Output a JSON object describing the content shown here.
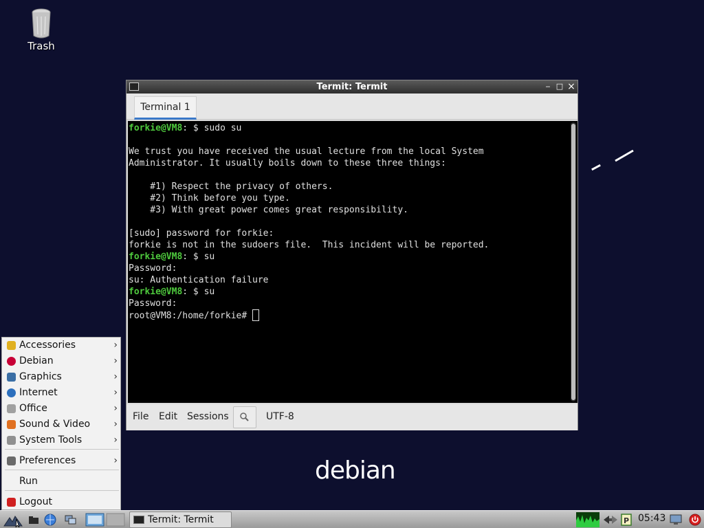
{
  "desktop": {
    "trash_label": "Trash",
    "logo_text": "debian"
  },
  "window": {
    "title": "Termit: Termit",
    "minimize": "‒",
    "maximize": "□",
    "close": "×"
  },
  "tabs": [
    {
      "label": "Terminal 1"
    }
  ],
  "terminal": {
    "lines": [
      {
        "prompt": "forkie@VM8",
        "text": ": $ sudo su"
      },
      {
        "text": ""
      },
      {
        "text": "We trust you have received the usual lecture from the local System"
      },
      {
        "text": "Administrator. It usually boils down to these three things:"
      },
      {
        "text": ""
      },
      {
        "text": "    #1) Respect the privacy of others."
      },
      {
        "text": "    #2) Think before you type."
      },
      {
        "text": "    #3) With great power comes great responsibility."
      },
      {
        "text": ""
      },
      {
        "text": "[sudo] password for forkie:"
      },
      {
        "text": "forkie is not in the sudoers file.  This incident will be reported."
      },
      {
        "prompt": "forkie@VM8",
        "text": ": $ su"
      },
      {
        "text": "Password:"
      },
      {
        "text": "su: Authentication failure"
      },
      {
        "prompt": "forkie@VM8",
        "text": ": $ su"
      },
      {
        "text": "Password:"
      },
      {
        "text": "root@VM8:/home/forkie# ",
        "cursor": true
      }
    ]
  },
  "menubar": {
    "file": "File",
    "edit": "Edit",
    "sessions": "Sessions",
    "encoding": "UTF-8"
  },
  "startmenu": {
    "items": [
      {
        "label": "Accessories",
        "icon": "accessories-icon",
        "color": "#e0b020",
        "submenu": true
      },
      {
        "label": "Debian",
        "icon": "debian-swirl-icon",
        "color": "#c70036",
        "submenu": true
      },
      {
        "label": "Graphics",
        "icon": "graphics-icon",
        "color": "#3a6ea5",
        "submenu": true
      },
      {
        "label": "Internet",
        "icon": "globe-icon",
        "color": "#2c6fbd",
        "submenu": true
      },
      {
        "label": "Office",
        "icon": "office-icon",
        "color": "#a0a0a0",
        "submenu": true
      },
      {
        "label": "Sound & Video",
        "icon": "sound-video-icon",
        "color": "#e07020",
        "submenu": true
      },
      {
        "label": "System Tools",
        "icon": "system-tools-icon",
        "color": "#909090",
        "submenu": true
      },
      {
        "label": "Preferences",
        "icon": "preferences-icon",
        "color": "#6a6a6a",
        "submenu": true
      },
      {
        "label": "Run",
        "icon": "",
        "color": "",
        "submenu": false
      },
      {
        "label": "Logout",
        "icon": "logout-icon",
        "color": "#d02020",
        "submenu": false
      }
    ],
    "arrow": "›"
  },
  "taskbar": {
    "task_label": "Termit: Termit",
    "clock": "05:43"
  }
}
